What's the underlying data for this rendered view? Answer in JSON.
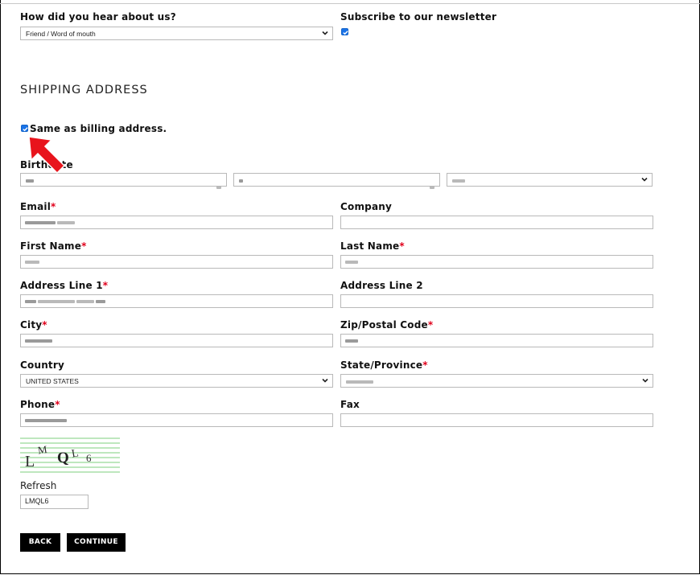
{
  "form": {
    "hear_about_label": "How did you hear about us?",
    "hear_about_value": "Friend / Word of mouth",
    "newsletter_label": "Subscribe to our newsletter",
    "newsletter_checked": true,
    "section_title": "SHIPPING ADDRESS",
    "same_as_billing_label": "Same as billing address.",
    "same_as_billing_checked": true,
    "birthdate_label": "Birthdate",
    "email_label": "Email",
    "company_label": "Company",
    "first_name_label": "First Name",
    "last_name_label": "Last Name",
    "address1_label": "Address Line 1",
    "address2_label": "Address Line 2",
    "city_label": "City",
    "zip_label": "Zip/Postal Code",
    "country_label": "Country",
    "country_value": "UNITED STATES",
    "state_label": "State/Province",
    "phone_label": "Phone",
    "fax_label": "Fax",
    "required_marker": "*",
    "captcha_chars": [
      "L",
      "M",
      "Q",
      "L",
      "6"
    ],
    "refresh_label": "Refresh",
    "captcha_input_value": "LMQL6",
    "back_label": "BACK",
    "continue_label": "CONTINUE"
  },
  "colors": {
    "required": "#e0001b",
    "checkbox": "#1a73e8",
    "button_bg": "#000000",
    "arrow": "#e8141c",
    "captcha_lines": "#7ccf7c"
  },
  "icons": {
    "select_chevron": "chevron-down-icon",
    "checkbox_mark": "checkmark-icon",
    "annotation": "red-arrow-icon"
  }
}
